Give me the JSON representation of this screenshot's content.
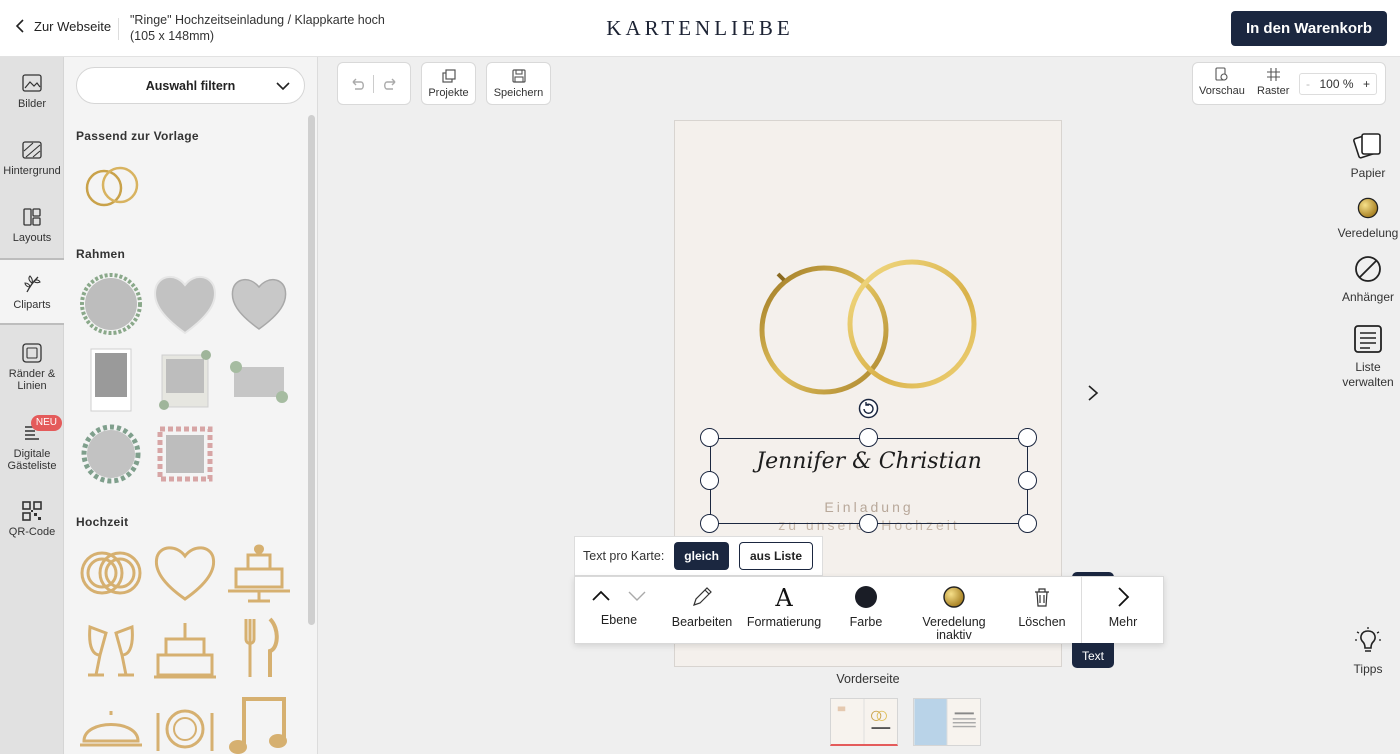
{
  "header": {
    "back_label": "Zur Webseite",
    "product_title_line1": "\"Ringe\" Hochzeitseinladung / Klappkarte hoch",
    "product_title_line2": "(105 x 148mm)",
    "brand": "KARTENLIEBE",
    "cart_button": "In den Warenkorb"
  },
  "rail": {
    "items": [
      {
        "label": "Bilder",
        "icon": "image-icon"
      },
      {
        "label": "Hintergrund",
        "icon": "background-icon"
      },
      {
        "label": "Layouts",
        "icon": "layout-icon"
      },
      {
        "label": "Cliparts",
        "icon": "clipart-icon"
      },
      {
        "label_line1": "Ränder &",
        "label_line2": "Linien",
        "icon": "frame-icon"
      },
      {
        "label_line1": "Digitale",
        "label_line2": "Gästeliste",
        "icon": "guestlist-icon",
        "badge": "NEU"
      },
      {
        "label": "QR-Code",
        "icon": "qr-icon"
      }
    ]
  },
  "panel": {
    "filter_label": "Auswahl filtern",
    "sections": {
      "template": "Passend zur Vorlage",
      "frames": "Rahmen",
      "wedding": "Hochzeit"
    }
  },
  "canvas_toolbar": {
    "projects": "Projekte",
    "save": "Speichern",
    "preview": "Vorschau",
    "grid": "Raster",
    "zoom": "100 %",
    "zoom_minus": "-",
    "zoom_plus": "+"
  },
  "card": {
    "names": "Jennifer & Christian",
    "invite_line1": "Einladung",
    "invite_line2": "zu unserer Hochzeit",
    "page_label": "Vorderseite"
  },
  "text_per_card": {
    "label": "Text pro Karte:",
    "option_same": "gleich",
    "option_list": "aus Liste"
  },
  "edit_toolbar": {
    "layer": "Ebene",
    "edit": "Bearbeiten",
    "format": "Formatierung",
    "color": "Farbe",
    "finish_line1": "Veredelung",
    "finish_line2": "inaktiv",
    "delete": "Löschen",
    "more": "Mehr",
    "text_tag": "Text"
  },
  "right_rail": {
    "paper": "Papier",
    "finish": "Veredelung",
    "tag": "Anhänger",
    "list_line1": "Liste",
    "list_line2": "verwalten",
    "tips": "Tipps"
  },
  "colors": {
    "navy": "#1b2740",
    "gold": "#c9a24a",
    "badge": "#e45b5b"
  }
}
